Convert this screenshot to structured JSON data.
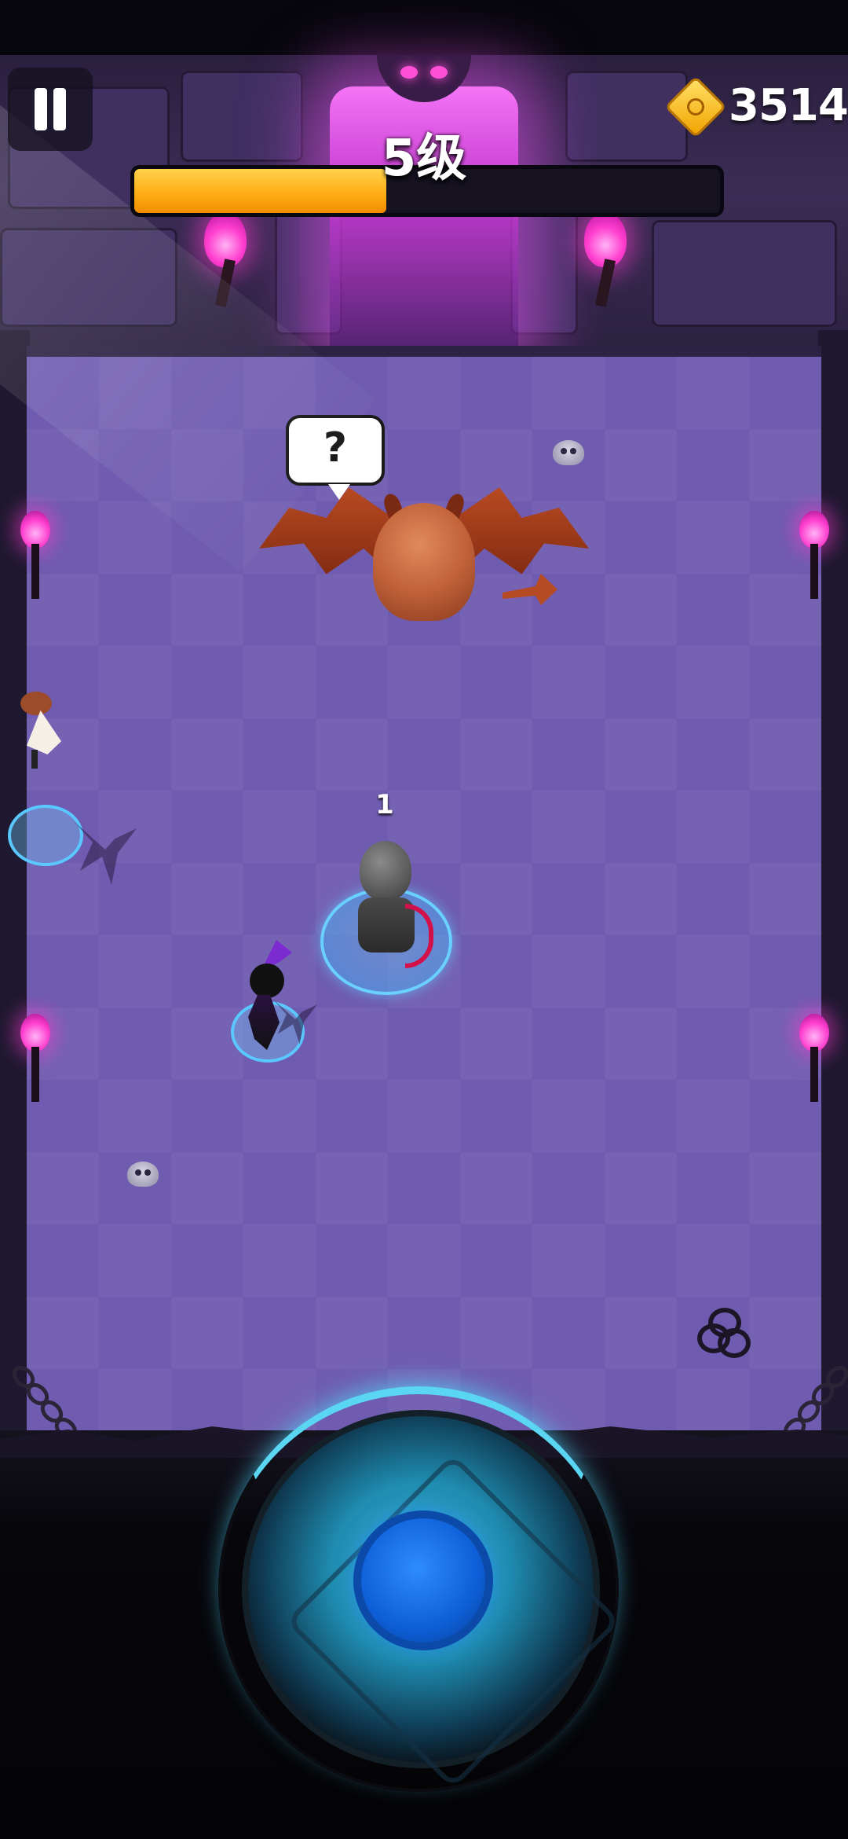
{
  "hud": {
    "coins": "3514",
    "level_label": "5级",
    "xp_progress": 0.43
  },
  "boss": {
    "speech_text": "?"
  },
  "hero": {
    "count_label": "1"
  },
  "icons": {
    "pause": "pause-icon",
    "coin": "coin-icon",
    "joystick": "joystick-icon"
  },
  "colors": {
    "xp_fill": "#ffab12",
    "arena_floor": "#6f5cb0",
    "joystick_knob": "#0e5fd8",
    "torch_flame": "#ff3fcf"
  }
}
